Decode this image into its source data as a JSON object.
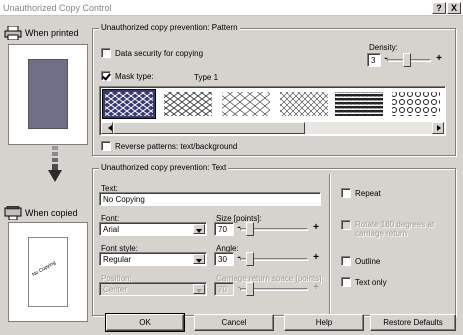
{
  "window": {
    "title": "Unauthorized Copy Control",
    "help_label": "?",
    "close_label": "X"
  },
  "left_panel": {
    "when_printed_label": "When printed",
    "when_copied_label": "When copied",
    "preview_text": "No Copying"
  },
  "pattern_group": {
    "title": "Unauthorized copy prevention: Pattern",
    "data_security_label": "Data security for copying",
    "data_security_checked": false,
    "mask_type_label": "Mask type:",
    "mask_type_checked": true,
    "mask_type_value": "Type 1",
    "density_label": "Density:",
    "density_value": "3",
    "reverse_label": "Reverse patterns: text/background",
    "reverse_checked": false
  },
  "text_group": {
    "title": "Unauthorized copy prevention: Text",
    "text_label": "Text:",
    "text_value": "No Copying",
    "font_label": "Font:",
    "font_value": "Arial",
    "size_label": "Size [points]:",
    "size_value": "70",
    "font_style_label": "Font style:",
    "font_style_value": "Regular",
    "angle_label": "Angle:",
    "angle_value": "30",
    "position_label": "Position:",
    "position_value": "Center",
    "carriage_label": "Carriage return space [points]:",
    "carriage_value": "70",
    "repeat_label": "Repeat",
    "rotate_label": "Rotate 180 degrees at carriage return",
    "outline_label": "Outline",
    "text_only_label": "Text only"
  },
  "buttons": {
    "ok": "OK",
    "cancel": "Cancel",
    "help": "Help",
    "restore": "Restore Defaults"
  },
  "colors": {
    "dialog_bg": "#d6d3ce",
    "preview_fill": "#6f6f88",
    "selection": "#3a3a72"
  }
}
